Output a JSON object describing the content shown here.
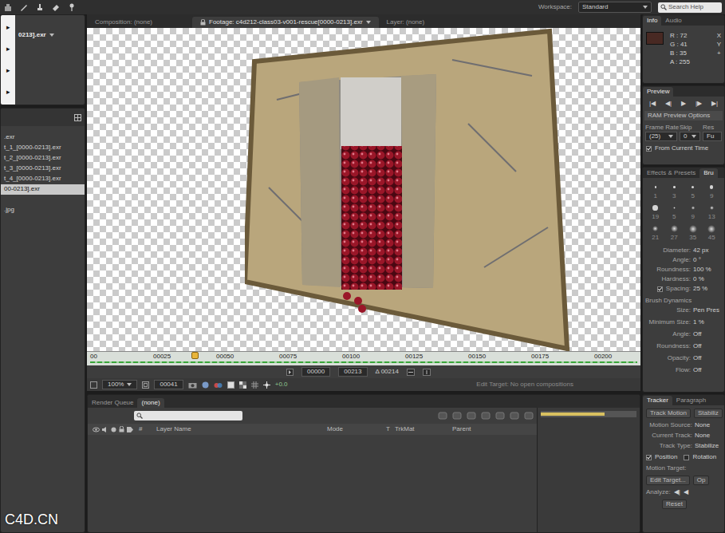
{
  "toolbar": {
    "workspace": {
      "label": "Workspace:",
      "value": "Standard"
    },
    "search": {
      "placeholder": "Search Help"
    }
  },
  "overlay_menu": {
    "arrows": [
      "▸",
      "▸",
      "▸",
      "▸"
    ]
  },
  "project": {
    "footage": "0213].exr",
    "items": [
      {
        "label": ".exr",
        "selected": false
      },
      {
        "label": "t_1_[0000-0213].exr",
        "selected": false
      },
      {
        "label": "t_2_[0000-0213].exr",
        "selected": false
      },
      {
        "label": "t_3_[0000-0213].exr",
        "selected": false
      },
      {
        "label": "t_4_[0000-0213].exr",
        "selected": false
      },
      {
        "label": "00-0213].exr",
        "selected": true
      },
      {
        "label": ".jpg",
        "selected": false
      }
    ]
  },
  "viewer": {
    "tabs": [
      {
        "label": "Composition: (none)",
        "selected": false
      },
      {
        "label": "Footage: c4d212-class03-v001-rescue[0000-0213].exr",
        "selected": true
      },
      {
        "label": "Layer: (none)",
        "selected": false
      }
    ],
    "ruler": {
      "ticks": [
        "00",
        "00025",
        "00050",
        "00075",
        "00100",
        "00125",
        "00150",
        "00175",
        "00200"
      ],
      "playhead": 0.19
    },
    "range": {
      "start": "00000",
      "end": "00213",
      "duration": "Δ 00214"
    },
    "controls": {
      "zoom": "100%",
      "frame": "00041",
      "exposure": "+0.0",
      "edit_target": "Edit Target: No open compositions"
    }
  },
  "timeline": {
    "tabs": [
      {
        "label": "Render Queue",
        "selected": false
      },
      {
        "label": "(none)",
        "selected": true
      }
    ],
    "columns": [
      "#",
      "Layer Name",
      "Mode",
      "T",
      "TrkMat",
      "Parent"
    ]
  },
  "info": {
    "tabs": [
      {
        "label": "Info",
        "selected": true
      },
      {
        "label": "Audio",
        "selected": false
      }
    ],
    "swatch": "#482923",
    "channels": [
      "R : 72",
      "G : 41",
      "B : 35",
      "A : 255"
    ],
    "cursor": {
      "marker": "+",
      "labels": [
        "X",
        "Y"
      ]
    }
  },
  "preview": {
    "title": "Preview",
    "buttons": [
      "|◀",
      "◀|",
      "▶",
      "|▶",
      "▶|"
    ],
    "options": "RAM Preview Options",
    "fields": [
      {
        "label": "Frame Rate",
        "value": "(25)"
      },
      {
        "label": "Skip",
        "value": "0"
      },
      {
        "label": "Res",
        "value": "Fu"
      }
    ],
    "from_current": {
      "label": "From Current Time",
      "checked": true
    }
  },
  "brushes": {
    "tabs": [
      {
        "label": "Effects & Presets",
        "selected": false
      },
      {
        "label": "Bru",
        "selected": true
      }
    ],
    "tips": [
      {
        "size": "1",
        "kind": "hard"
      },
      {
        "size": "3",
        "kind": "hard"
      },
      {
        "size": "5",
        "kind": "hard"
      },
      {
        "size": "9",
        "kind": "hard"
      },
      {
        "size": "19",
        "kind": "hard"
      },
      {
        "size": "5",
        "kind": "soft"
      },
      {
        "size": "9",
        "kind": "soft"
      },
      {
        "size": "13",
        "kind": "soft"
      },
      {
        "size": "21",
        "kind": "soft"
      },
      {
        "size": "27",
        "kind": "soft"
      },
      {
        "size": "35",
        "kind": "soft"
      },
      {
        "size": "45",
        "kind": "soft"
      }
    ],
    "properties": [
      {
        "label": "Diameter:",
        "value": "42 px",
        "kind": "value",
        "checked": false
      },
      {
        "label": "Angle:",
        "value": "0 °",
        "kind": "value",
        "checked": false
      },
      {
        "label": "Roundness:",
        "value": "100 %",
        "kind": "value",
        "checked": false
      },
      {
        "label": "Hardness:",
        "value": "0 %",
        "kind": "value",
        "checked": false
      },
      {
        "label": "Spacing:",
        "value": "25 %",
        "kind": "checkbox",
        "checked": true
      }
    ],
    "dynamics_title": "Brush Dynamics",
    "dynamics": [
      {
        "label": "Size:",
        "value": "Pen Pres"
      },
      {
        "label": "Minimum Size:",
        "value": "1 %"
      },
      {
        "label": "Angle:",
        "value": "Off"
      },
      {
        "label": "Roundness:",
        "value": "Off"
      },
      {
        "label": "Opacity:",
        "value": "Off"
      },
      {
        "label": "Flow:",
        "value": "Off"
      }
    ]
  },
  "tracker": {
    "tabs": [
      {
        "label": "Tracker",
        "selected": true
      },
      {
        "label": "Paragraph",
        "selected": false
      }
    ],
    "buttons": [
      "Track Motion",
      "Stabiliz"
    ],
    "fields": [
      {
        "label": "Motion Source:",
        "value": "None"
      },
      {
        "label": "Current Track:",
        "value": "None"
      },
      {
        "label": "Track Type:",
        "value": "Stabilize"
      }
    ],
    "options": [
      {
        "label": "Position",
        "checked": true
      },
      {
        "label": "Rotation",
        "checked": false
      }
    ],
    "motion_target": "Motion Target:",
    "edit_target": "Edit Target...",
    "edit_extra": "Op",
    "analyze": {
      "label": "Analyze:",
      "buttons": [
        "◀|",
        "◀"
      ]
    },
    "reset": "Reset"
  },
  "watermark": "C4D.CN"
}
